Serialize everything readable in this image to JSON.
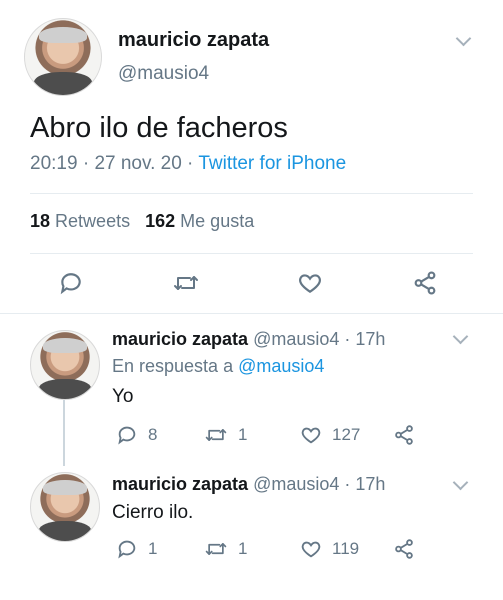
{
  "main_tweet": {
    "display_name": "mauricio zapata",
    "handle": "@mausio4",
    "text": "Abro ilo de facheros",
    "time": "20:19",
    "date": "27 nov. 20",
    "source": "Twitter for iPhone",
    "retweets_count": "18",
    "retweets_label": "Retweets",
    "likes_count": "162",
    "likes_label": "Me gusta"
  },
  "replies": [
    {
      "display_name": "mauricio zapata",
      "handle": "@mausio4",
      "age": "17h",
      "reply_prefix": "En respuesta a",
      "reply_to": "@mausio4",
      "text": "Yo",
      "reply_count": "8",
      "retweet_count": "1",
      "like_count": "127"
    },
    {
      "display_name": "mauricio zapata",
      "handle": "@mausio4",
      "age": "17h",
      "text": "Cierro ilo.",
      "reply_count": "1",
      "retweet_count": "1",
      "like_count": "119"
    }
  ],
  "colors": {
    "text": "#14171a",
    "muted": "#657786",
    "link": "#1b95e0",
    "divider": "#e6ecf0"
  },
  "icons": [
    "reply-icon",
    "retweet-icon",
    "like-icon",
    "share-icon",
    "chevron-down-icon"
  ]
}
